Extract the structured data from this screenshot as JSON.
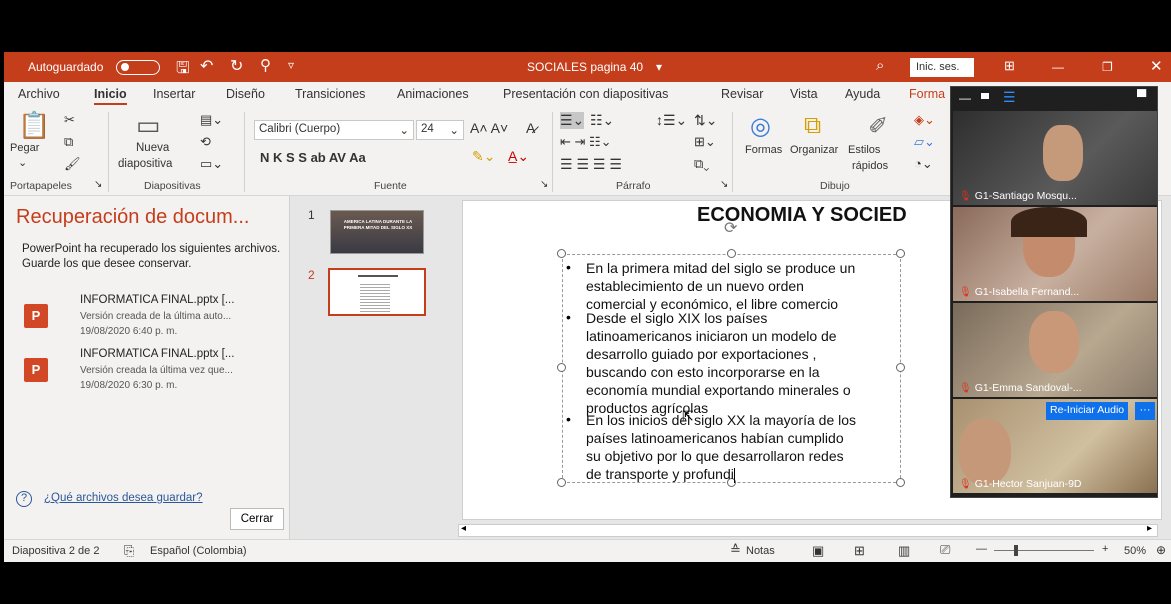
{
  "window": {
    "autosave_label": "Autoguardado",
    "doc_title": "SOCIALES pagina 40",
    "signin_label": "Inic. ses."
  },
  "menu": [
    "Archivo",
    "Inicio",
    "Insertar",
    "Diseño",
    "Transiciones",
    "Animaciones",
    "Presentación con diapositivas",
    "Revisar",
    "Vista",
    "Ayuda",
    "Forma"
  ],
  "ribbon": {
    "paste": "Pegar",
    "new_slide_1": "Nueva",
    "new_slide_2": "diapositiva",
    "font_name": "Calibri (Cuerpo)",
    "font_size": "24",
    "format_buttons": "N  K  S  S  ab  AV  Aa",
    "shapes": "Formas",
    "arrange": "Organizar",
    "styles_1": "Estilos",
    "styles_2": "rápidos",
    "groups": {
      "clipboard": "Portapapeles",
      "slides": "Diapositivas",
      "font": "Fuente",
      "paragraph": "Párrafo",
      "drawing": "Dibujo"
    }
  },
  "recovery": {
    "title": "Recuperación de docum...",
    "message": "PowerPoint ha recuperado los siguientes archivos. Guarde los que desee conservar.",
    "files": [
      {
        "name": "INFORMATICA FINAL.pptx  [...",
        "desc": "Versión creada de la última auto...",
        "date": "19/08/2020 6:40 p. m."
      },
      {
        "name": "INFORMATICA FINAL.pptx  [...",
        "desc": "Versión creada la última vez que...",
        "date": "19/08/2020 6:30 p. m."
      }
    ],
    "help_link": "¿Qué archivos desea guardar?",
    "close_btn": "Cerrar"
  },
  "thumbnails": [
    {
      "num": "1",
      "text": "AMERICA LATINA DURANTE LA PRIMERA MITAD DEL SIGLO XX"
    },
    {
      "num": "2"
    }
  ],
  "slide": {
    "title": "ECONOMIA Y SOCIED",
    "bullets": [
      [
        "En la primera mitad del siglo se produce un",
        "establecimiento de un nuevo orden",
        "comercial y económico, el libre comercio"
      ],
      [
        "Desde el siglo XIX los países",
        "latinoamericanos iniciaron un modelo de",
        "desarrollo guiado por exportaciones ,",
        "buscando con esto incorporarse en la",
        "economía mundial exportando minerales o",
        "productos agrícolas"
      ],
      [
        "En los inicios del siglo XX la mayoría de los",
        "países latinoamericanos habían cumplido",
        "su objetivo por lo que desarrollaron redes",
        "de transporte y profundi"
      ]
    ]
  },
  "status": {
    "slide_info": "Diapositiva 2 de 2",
    "language": "Español (Colombia)",
    "notes": "Notas",
    "zoom": "50%"
  },
  "zoom_panel": {
    "participants": [
      {
        "name": "G1-Santiago Mosqu...",
        "bg": "#3a3a3a"
      },
      {
        "name": "G1-Isabella Fernand...",
        "bg": "#a08070"
      },
      {
        "name": "G1-Emma Sandoval-...",
        "bg": "#8a7a6a"
      },
      {
        "name": "G1-Hector Sanjuan-9D",
        "bg": "#b0a080"
      }
    ],
    "reaudio_label": "Re-Iniciar Audio",
    "more_label": "···"
  },
  "colors": {
    "accent": "#c43e1c",
    "zoom_blue": "#0e71eb"
  }
}
